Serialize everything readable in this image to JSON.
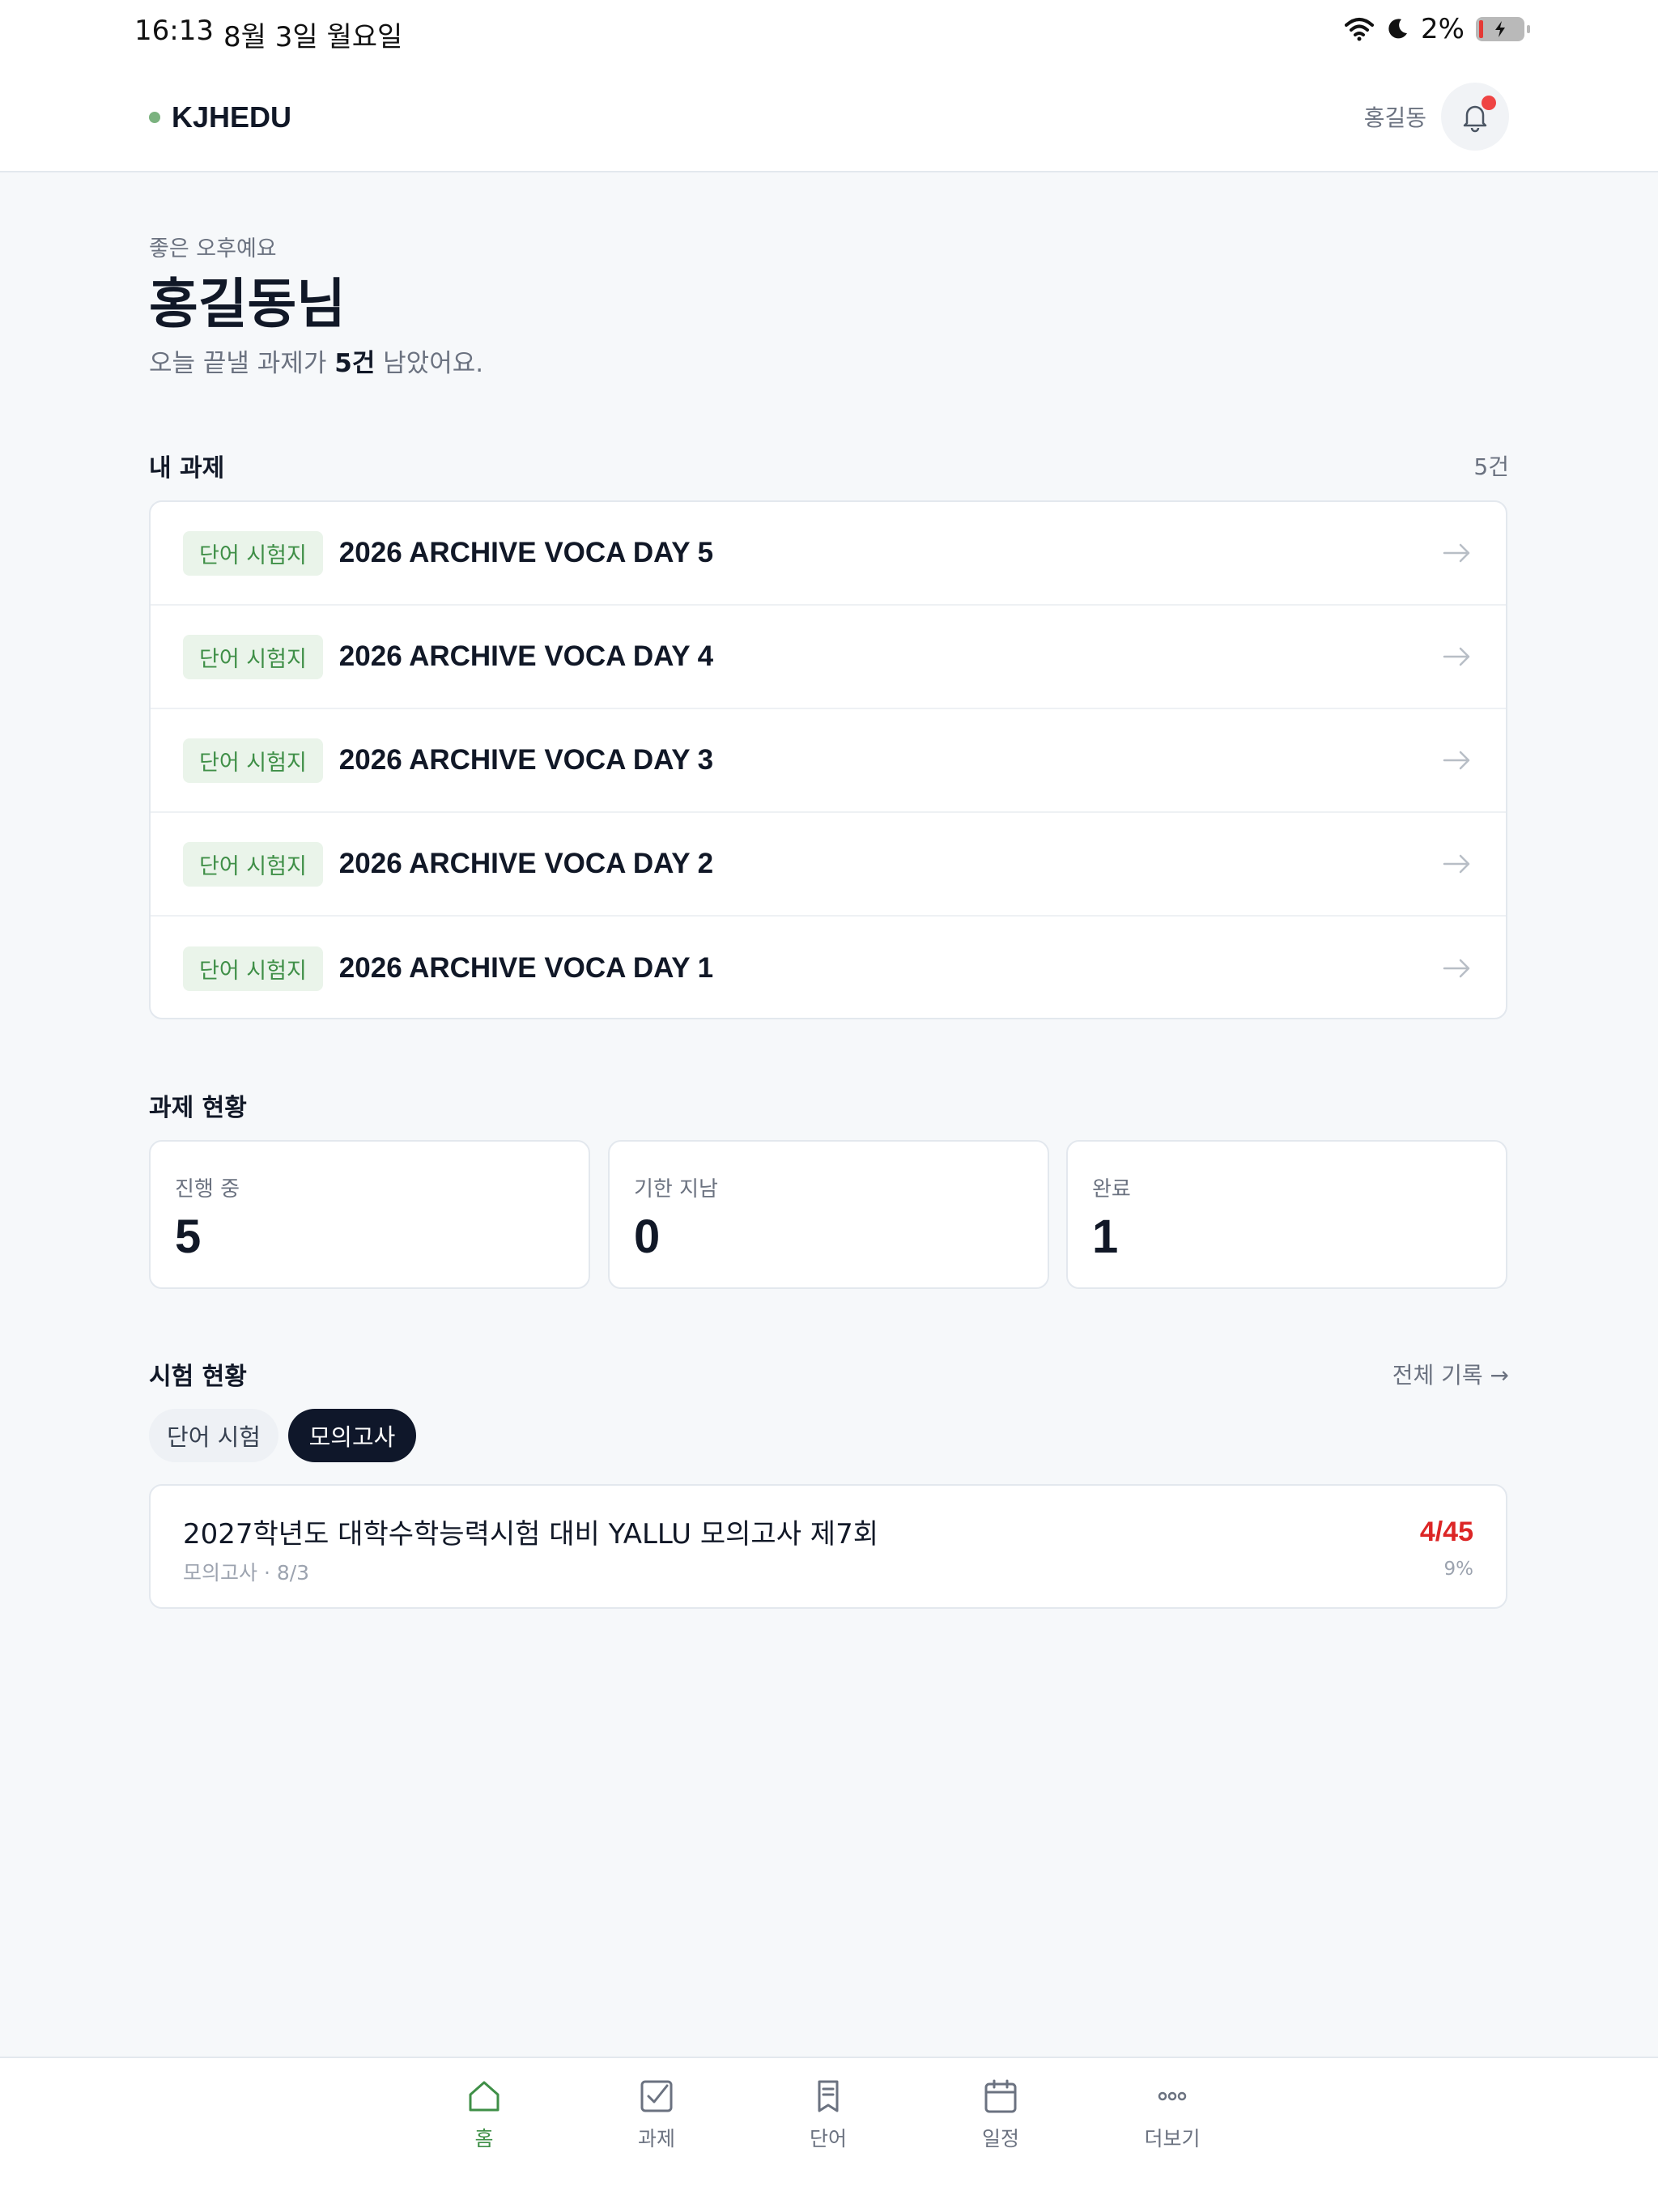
{
  "status_bar": {
    "time": "16:13",
    "date": "8월 3일 월요일",
    "battery_pct": "2%"
  },
  "header": {
    "brand": "KJHEDU",
    "brand_dot_color": "#7bb27f",
    "user_name": "홍길동",
    "notification_badge_color": "#ef4444"
  },
  "greeting": {
    "subtitle": "좋은 오후예요",
    "title": "홍길동님",
    "msg_prefix": "오늘 끝낼 과제가 ",
    "msg_count": "5건",
    "msg_suffix": " 남았어요."
  },
  "tasks": {
    "title": "내 과제",
    "count": "5건",
    "items": [
      {
        "tag": "단어 시험지",
        "title": "2026 ARCHIVE VOCA DAY 5"
      },
      {
        "tag": "단어 시험지",
        "title": "2026 ARCHIVE VOCA DAY 4"
      },
      {
        "tag": "단어 시험지",
        "title": "2026 ARCHIVE VOCA DAY 3"
      },
      {
        "tag": "단어 시험지",
        "title": "2026 ARCHIVE VOCA DAY 2"
      },
      {
        "tag": "단어 시험지",
        "title": "2026 ARCHIVE VOCA DAY 1"
      }
    ]
  },
  "task_status": {
    "title": "과제 현황",
    "cards": [
      {
        "label": "진행 중",
        "value": "5"
      },
      {
        "label": "기한 지남",
        "value": "0"
      },
      {
        "label": "완료",
        "value": "1"
      }
    ]
  },
  "exam_status": {
    "title": "시험 현황",
    "all_records": "전체 기록 →",
    "tabs": [
      "단어 시험",
      "모의고사"
    ],
    "selected_tab": "모의고사",
    "item": {
      "title": "2027학년도 대학수학능력시험 대비 YALLU 모의고사 제7회",
      "meta": "모의고사 · 8/3",
      "score": "4/45",
      "percent": "9%",
      "score_color": "#dc2626"
    }
  },
  "tabbar": {
    "items": [
      {
        "label": "홈",
        "icon": "home-icon",
        "active": true
      },
      {
        "label": "과제",
        "icon": "checkbox-icon",
        "active": false
      },
      {
        "label": "단어",
        "icon": "bookmark-icon",
        "active": false
      },
      {
        "label": "일정",
        "icon": "calendar-icon",
        "active": false
      },
      {
        "label": "더보기",
        "icon": "more-icon",
        "active": false
      }
    ],
    "active_color": "#3f8f47"
  }
}
